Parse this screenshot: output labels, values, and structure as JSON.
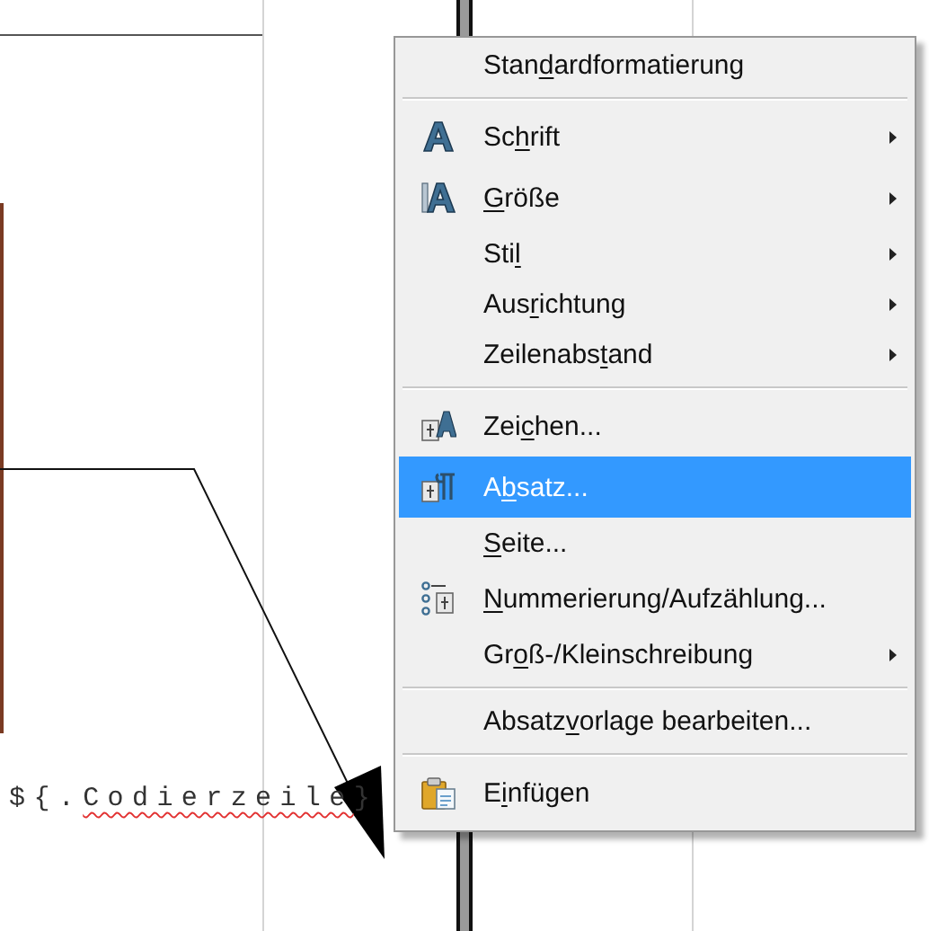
{
  "document": {
    "code_field": [
      {
        "text": "${.",
        "misspelled": false
      },
      {
        "text": "Codierzeile",
        "misspelled": true
      },
      {
        "text": "}",
        "misspelled": false
      }
    ]
  },
  "context_menu": {
    "items": [
      {
        "kind": "item",
        "label": "Standardformatierung",
        "submenu": false,
        "selected": false
      },
      {
        "kind": "separator"
      },
      {
        "kind": "item",
        "label": "Schrift",
        "submenu": true,
        "selected": false
      },
      {
        "kind": "item",
        "label": "Größe",
        "submenu": true,
        "selected": false
      },
      {
        "kind": "item",
        "label": "Stil",
        "submenu": true,
        "selected": false
      },
      {
        "kind": "item",
        "label": "Ausrichtung",
        "submenu": true,
        "selected": false
      },
      {
        "kind": "item",
        "label": "Zeilenabstand",
        "submenu": true,
        "selected": false
      },
      {
        "kind": "separator"
      },
      {
        "kind": "item",
        "label": "Zeichen...",
        "submenu": false,
        "selected": false
      },
      {
        "kind": "item",
        "label": "Absatz...",
        "submenu": false,
        "selected": true
      },
      {
        "kind": "item",
        "label": "Seite...",
        "submenu": false,
        "selected": false
      },
      {
        "kind": "item",
        "label": "Nummerierung/Aufzählung...",
        "submenu": false,
        "selected": false
      },
      {
        "kind": "item",
        "label": "Groß-/Kleinschreibung",
        "submenu": true,
        "selected": false
      },
      {
        "kind": "separator"
      },
      {
        "kind": "item",
        "label": "Absatzvorlage bearbeiten...",
        "submenu": false,
        "selected": false
      },
      {
        "kind": "separator"
      },
      {
        "kind": "item",
        "label": "Einfügen",
        "submenu": false,
        "selected": false
      }
    ]
  }
}
